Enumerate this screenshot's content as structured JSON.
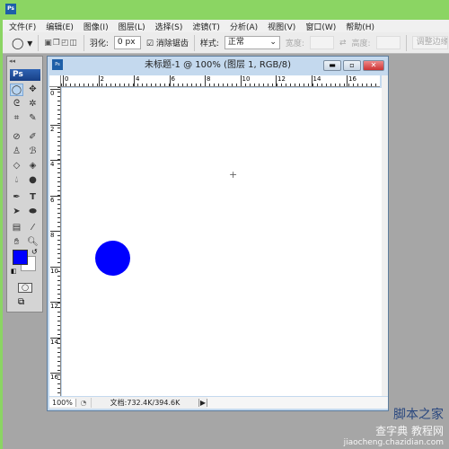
{
  "app": {
    "icon_label": "Ps"
  },
  "menu": [
    "文件(F)",
    "编辑(E)",
    "图像(I)",
    "图层(L)",
    "选择(S)",
    "滤镜(T)",
    "分析(A)",
    "视图(V)",
    "窗口(W)",
    "帮助(H)"
  ],
  "options": {
    "feather_label": "羽化:",
    "feather_value": "0 px",
    "antialias_label": "消除锯齿",
    "antialias_checked": true,
    "style_label": "样式:",
    "style_value": "正常",
    "width_label": "宽度:",
    "height_label": "高度:",
    "refine_label": "调整边缘"
  },
  "toolbox": {
    "title": "Ps",
    "foreground": "#0000ff",
    "background": "#ffffff"
  },
  "document": {
    "title": "未标题-1 @ 100% (图层 1, RGB/8)",
    "ruler_top": [
      "0",
      "2",
      "4",
      "6",
      "8",
      "10",
      "12",
      "14",
      "16"
    ],
    "ruler_left": [
      "0",
      "2",
      "4",
      "6",
      "8",
      "10",
      "12",
      "14",
      "16"
    ],
    "shape_color": "#0000ff",
    "zoom": "100%",
    "doc_info": "文档:732.4K/394.6K"
  },
  "watermark": {
    "line1": "脚本之家",
    "line2": "查字典 教程网",
    "line3": "jiaocheng.chazidian.com"
  }
}
